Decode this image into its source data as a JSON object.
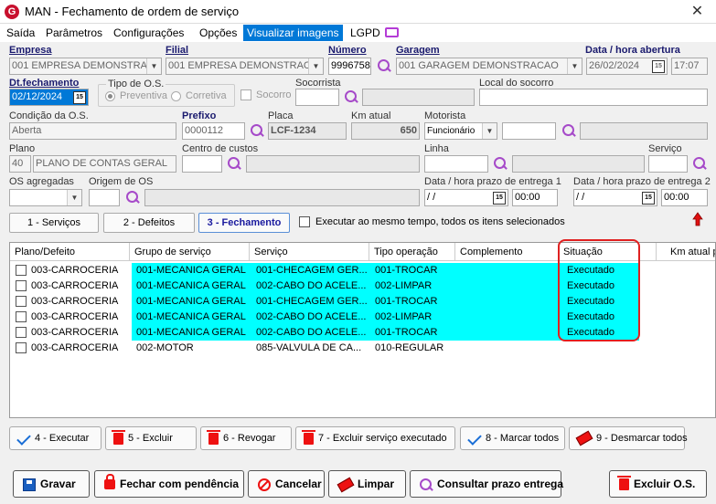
{
  "window": {
    "title": "MAN - Fechamento de ordem de serviço",
    "close_glyph": "✕",
    "icon_letter": "G"
  },
  "menu": {
    "items": [
      "Saída",
      "Parâmetros",
      "Configurações",
      "Opções",
      "Visualizar imagens",
      "LGPD"
    ]
  },
  "form": {
    "empresa_label": "Empresa",
    "empresa_value": "001 EMPRESA DEMONSTRACI",
    "filial_label": "Filial",
    "filial_value": "001 EMPRESA DEMONSTRACA",
    "numero_label": "Número",
    "numero_value": "9996758",
    "garagem_label": "Garagem",
    "garagem_value": "001 GARAGEM DEMONSTRACAO",
    "data_abertura_label": "Data / hora abertura",
    "data_abertura_date": "26/02/2024",
    "data_abertura_time": "17:07",
    "dt_fechamento_label": "Dt.fechamento",
    "dt_fechamento_value": "02/12/2024",
    "tipo_os_label": "Tipo de O.S.",
    "tipo_os_preventiva": "Preventiva",
    "tipo_os_corretiva": "Corretiva",
    "socorro_label": "Socorro",
    "socorrista_label": "Socorrista",
    "local_socorro_label": "Local do socorro",
    "condicao_label": "Condição da O.S.",
    "condicao_value": "Aberta",
    "prefixo_label": "Prefixo",
    "prefixo_value": "0000112",
    "placa_label": "Placa",
    "placa_value": "LCF-1234",
    "km_atual_label": "Km atual",
    "km_atual_value": "650",
    "motorista_label": "Motorista",
    "motorista_select": "Funcionário",
    "plano_label": "Plano",
    "plano_code": "40",
    "plano_value": "PLANO DE CONTAS GERAL",
    "centro_custos_label": "Centro de custos",
    "linha_label": "Linha",
    "servico_label": "Serviço",
    "os_agregadas_label": "OS agregadas",
    "origem_os_label": "Origem de OS",
    "prazo1_label": "Data / hora prazo de entrega 1",
    "prazo1_date": " /  /",
    "prazo1_time": "00:00",
    "prazo2_label": "Data / hora prazo de entrega 2",
    "prazo2_date": " /  /",
    "prazo2_time": "00:00"
  },
  "tabs": {
    "servicos": "1 - Serviços",
    "defeitos": "2 - Defeitos",
    "fechamento": "3 - Fechamento",
    "executar_todos_label": "Executar ao mesmo tempo, todos os itens selecionados"
  },
  "grid": {
    "columns": [
      "Plano/Defeito",
      "Grupo de serviço",
      "Serviço",
      "Tipo operação",
      "Complemento",
      "Situação",
      "Km atual pl"
    ],
    "rows": [
      {
        "plano": "003-CARROCERIA",
        "grupo": "001-MECANICA GERAL",
        "servico": "001-CHECAGEM GER...",
        "tipo": "001-TROCAR",
        "complemento": "",
        "situacao": "Executado",
        "highlight": true
      },
      {
        "plano": "003-CARROCERIA",
        "grupo": "001-MECANICA GERAL",
        "servico": "002-CABO DO ACELE...",
        "tipo": "002-LIMPAR",
        "complemento": "",
        "situacao": "Executado",
        "highlight": true
      },
      {
        "plano": "003-CARROCERIA",
        "grupo": "001-MECANICA GERAL",
        "servico": "001-CHECAGEM GER...",
        "tipo": "001-TROCAR",
        "complemento": "",
        "situacao": "Executado",
        "highlight": true
      },
      {
        "plano": "003-CARROCERIA",
        "grupo": "001-MECANICA GERAL",
        "servico": "002-CABO DO ACELE...",
        "tipo": "002-LIMPAR",
        "complemento": "",
        "situacao": "Executado",
        "highlight": true
      },
      {
        "plano": "003-CARROCERIA",
        "grupo": "001-MECANICA GERAL",
        "servico": "002-CABO DO ACELE...",
        "tipo": "001-TROCAR",
        "complemento": "",
        "situacao": "Executado",
        "highlight": true
      },
      {
        "plano": "003-CARROCERIA",
        "grupo": "002-MOTOR",
        "servico": "085-VALVULA DE CA...",
        "tipo": "010-REGULAR",
        "complemento": "",
        "situacao": "",
        "highlight": false
      }
    ]
  },
  "actions": {
    "executar": "4 - Executar",
    "excluir": "5 - Excluir",
    "revogar": "6 - Revogar",
    "excluir_executado": "7 - Excluir serviço executado",
    "marcar_todos": "8 - Marcar todos",
    "desmarcar_todos": "9 - Desmarcar todos"
  },
  "footer": {
    "gravar": "Gravar",
    "fechar_pendencia": "Fechar com pendência",
    "cancelar": "Cancelar",
    "limpar": "Limpar",
    "consultar_prazo": "Consultar prazo entrega",
    "excluir_os": "Excluir O.S."
  },
  "colors": {
    "accent": "#0078d7",
    "highlight_row": "#00ffff",
    "situacao_border": "#e02020",
    "search_icon": "#a64ac9"
  }
}
